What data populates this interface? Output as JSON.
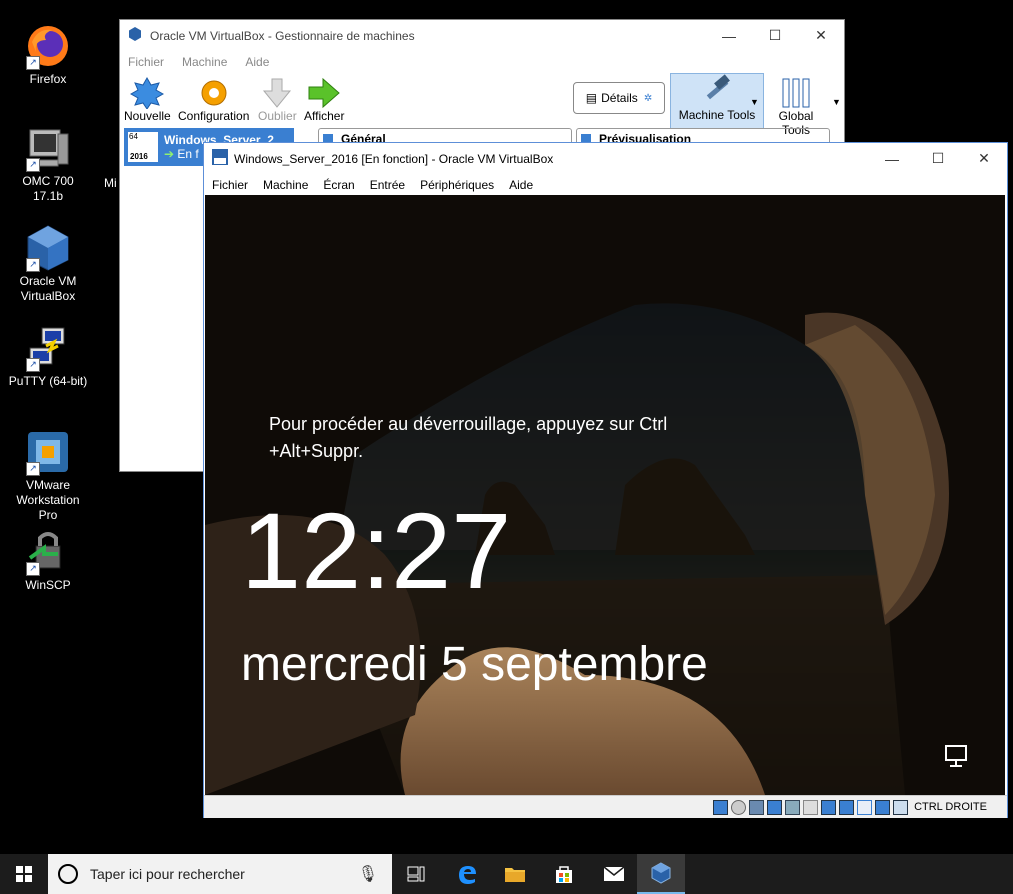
{
  "desktop": {
    "icons": [
      {
        "label": "Firefox"
      },
      {
        "label": "OMC 700 17.1b"
      },
      {
        "label": "Oracle VM VirtualBox"
      },
      {
        "label": "PuTTY (64-bit)"
      },
      {
        "label": "VMware Workstation Pro"
      },
      {
        "label": "WinSCP"
      }
    ],
    "partial_label": "Mi"
  },
  "manager_window": {
    "title": "Oracle VM VirtualBox - Gestionnaire de machines",
    "menu": [
      "Fichier",
      "Machine",
      "Aide"
    ],
    "toolbar": {
      "new": "Nouvelle",
      "settings": "Configuration",
      "discard": "Oublier",
      "show": "Afficher",
      "details": "Détails",
      "machine_tools": "Machine Tools",
      "global_tools": "Global Tools"
    },
    "vm_item": {
      "name": "Windows_Server_2",
      "status": "En f",
      "badge_top": "64",
      "badge_bottom": "2016"
    },
    "panels": {
      "general": "Général",
      "preview": "Prévisualisation"
    }
  },
  "vm_window": {
    "title": "Windows_Server_2016 [En fonction] - Oracle VM VirtualBox",
    "menu": [
      "Fichier",
      "Machine",
      "Écran",
      "Entrée",
      "Périphériques",
      "Aide"
    ],
    "lockscreen": {
      "unlock_hint_line1": "Pour procéder au déverrouillage, appuyez sur Ctrl",
      "unlock_hint_line2": "+Alt+Suppr.",
      "time": "12:27",
      "date": "mercredi 5 septembre"
    },
    "status": {
      "host_key": "CTRL DROITE"
    }
  },
  "taskbar": {
    "search_placeholder": "Taper ici pour rechercher"
  },
  "colors": {
    "selection": "#3a7fd1",
    "taskbar": "#1c1c1c",
    "active_border": "#5d8fd8"
  }
}
